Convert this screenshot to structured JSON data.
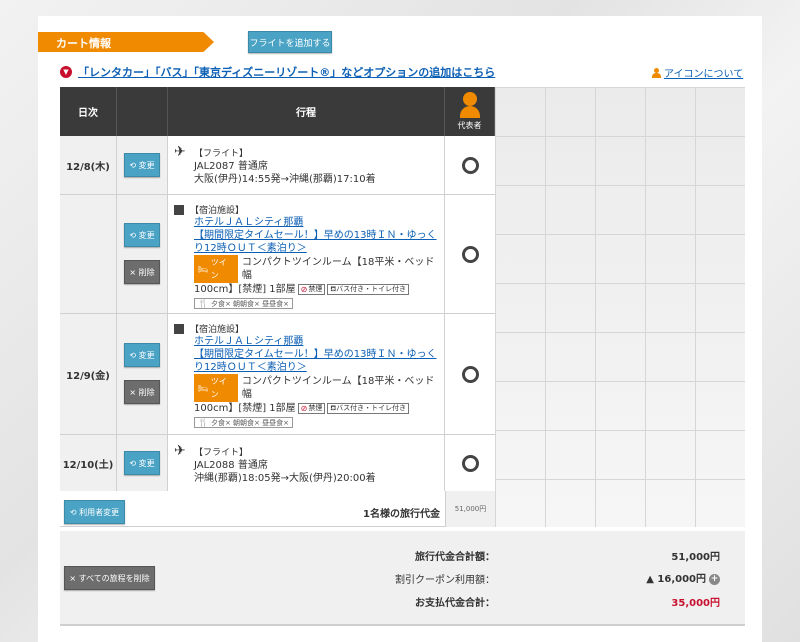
{
  "header": {
    "cart_title": "カート情報",
    "add_flight_label": "フライトを追加する",
    "option_link": "「レンタカー」「バス」「東京ディズニーリゾート®」などオプションの追加はこちら",
    "icon_about": "アイコンについて"
  },
  "table": {
    "col_date": "日次",
    "col_itinerary": "行程",
    "col_representative": "代表者"
  },
  "buttons": {
    "change": "変更",
    "delete": "削除",
    "change_users": "利用者変更",
    "delete_all": "すべての旅程を削除"
  },
  "rows": [
    {
      "date": "12/8(木)",
      "type": "【フライト】",
      "lines": [
        "JAL2087 普通席",
        "大阪(伊丹)14:55発→沖縄(那覇)17:10着"
      ]
    },
    {
      "type": "【宿泊施設】",
      "hotel": "ホテルＪＡＬシティ那覇",
      "plan": [
        "【期間限定タイムセール！】早めの13時ＩＮ・ゆっく",
        "り12時ＯＵＴ＜素泊り＞"
      ],
      "badge": "ツイン",
      "room_a": "コンパクトツインルーム【18平米・ベッド幅",
      "room_b": "100cm】[禁煙] 1部屋",
      "tag_nosmoke": "禁煙",
      "tag_bath": "バス付き・トイレ付き",
      "meal": "夕食× 朝朝食× 昼昼食×"
    },
    {
      "date": "12/9(金)",
      "type": "【宿泊施設】",
      "hotel": "ホテルＪＡＬシティ那覇",
      "plan": [
        "【期間限定タイムセール！】早めの13時ＩＮ・ゆっく",
        "り12時ＯＵＴ＜素泊り＞"
      ],
      "badge": "ツイン",
      "room_a": "コンパクトツインルーム【18平米・ベッド幅",
      "room_b": "100cm】[禁煙] 1部屋",
      "tag_nosmoke": "禁煙",
      "tag_bath": "バス付き・トイレ付き",
      "meal": "夕食× 朝朝食× 昼昼食×"
    },
    {
      "date": "12/10(土)",
      "type": "【フライト】",
      "lines": [
        "JAL2088 普通席",
        "沖縄(那覇)18:05発→大阪(伊丹)20:00着"
      ]
    }
  ],
  "per_person": {
    "label": "1名様の旅行代金",
    "value": "51,000円"
  },
  "summary": {
    "total_label": "旅行代金合計額：",
    "total_value": "51,000円",
    "coupon_label": "割引クーポン利用額：",
    "coupon_value": "▲ 16,000円",
    "pay_label": "お支払代金合計：",
    "pay_value": "35,000円",
    "pay_color": "#c8102e"
  },
  "colors": {
    "accent_orange": "#f08a00",
    "button_blue": "#4aa3c4",
    "link_blue": "#0b5fb4",
    "header_dark": "#3a3a3a"
  }
}
